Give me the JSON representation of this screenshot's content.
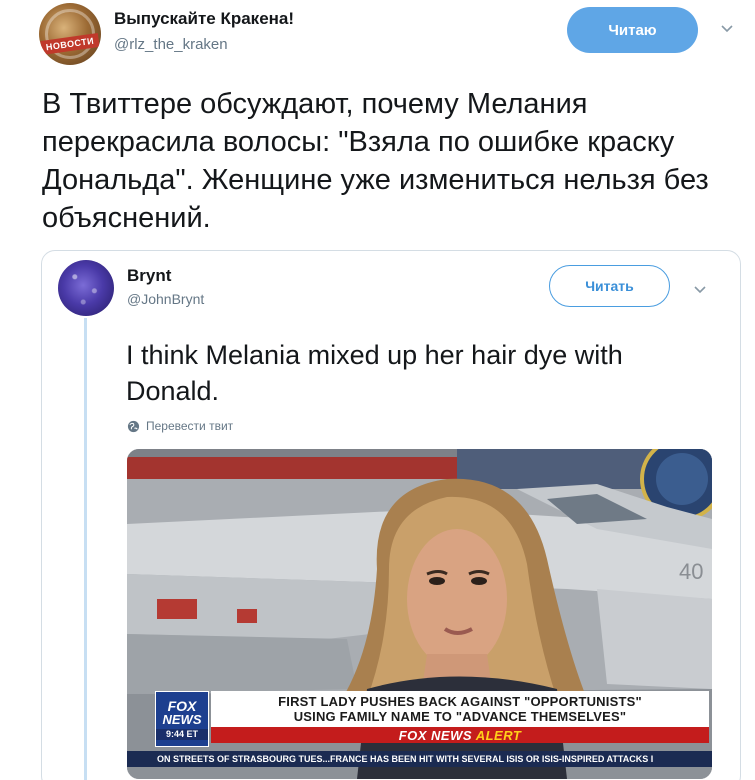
{
  "tweet": {
    "author_name": "Выпускайте Кракена!",
    "author_handle": "@rlz_the_kraken",
    "avatar_text": "НОВОСТИ",
    "follow_label": "Читаю",
    "text": "В Твиттере обсуждают, почему Мелания перекрасила волосы: \"Взяла по ошибке краску Дональда\". Женщине уже измениться нельзя без объяснений."
  },
  "quoted": {
    "author_name": "Brynt",
    "author_handle": "@JohnBrynt",
    "follow_label": "Читать",
    "text": "I think Melania mixed up her hair dye with Donald.",
    "translate_label": "Перевести твит"
  },
  "media": {
    "fox_logo_line1": "FOX",
    "fox_logo_line2": "NEWS",
    "time": "9:44 ET",
    "headline_line1": "FIRST LADY PUSHES BACK AGAINST \"OPPORTUNISTS\"",
    "headline_line2": "USING FAMILY NAME TO \"ADVANCE THEMSELVES\"",
    "alert_prefix": "FOX NEWS",
    "alert_word": "ALERT",
    "ticker": "ON STREETS OF STRASBOURG TUES...FRANCE HAS BEEN HIT WITH SEVERAL ISIS OR ISIS-INSPIRED ATTACKS I",
    "jet_number": "40"
  },
  "colors": {
    "follow_filled": "#5fa6e6",
    "follow_outline": "#4a9de0",
    "thread_line": "#c7dff3",
    "fox_blue": "#1d3f8f",
    "alert_red": "#c41c1c"
  },
  "icons": [
    "chevron-down-icon",
    "globe-icon"
  ]
}
